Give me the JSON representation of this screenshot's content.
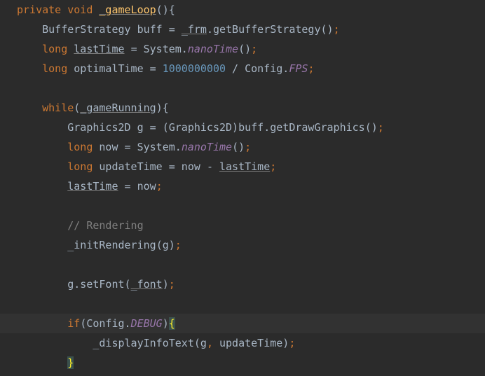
{
  "code": {
    "l1": {
      "kw1": "private",
      "kw2": "void",
      "fn": "_gameLoop",
      "p": "(){",
      "indent": ""
    },
    "l2": {
      "indent": "    ",
      "t1": "BufferStrategy buff ",
      "op": "=",
      "sp": " ",
      "fld": "_frm",
      "t2": ".getBufferStrategy()",
      "semi": ";"
    },
    "l3": {
      "indent": "    ",
      "kw": "long",
      "sp": " ",
      "var": "lastTime",
      "t1": " ",
      "op": "=",
      "t2": " System.",
      "stat": "nanoTime",
      "t3": "()",
      "semi": ";"
    },
    "l4": {
      "indent": "    ",
      "kw": "long",
      "t1": " optimalTime ",
      "op": "=",
      "sp": " ",
      "num": "1000000000",
      "t2": " / Config.",
      "stat": "FPS",
      "semi": ";"
    },
    "l5": {
      "blank": ""
    },
    "l6": {
      "indent": "    ",
      "kw": "while",
      "p1": "(",
      "fld": "_gameRunning",
      "p2": "){"
    },
    "l7": {
      "indent": "        ",
      "t1": "Graphics2D g ",
      "op": "=",
      "t2": " (Graphics2D)buff.getDrawGraphics()",
      "semi": ";"
    },
    "l8": {
      "indent": "        ",
      "kw": "long",
      "t1": " now ",
      "op": "=",
      "t2": " System.",
      "stat": "nanoTime",
      "t3": "()",
      "semi": ";"
    },
    "l9": {
      "indent": "        ",
      "kw": "long",
      "t1": " updateTime ",
      "op": "=",
      "t2": " now ",
      "op2": "-",
      "sp": " ",
      "var": "lastTime",
      "semi": ";"
    },
    "l10": {
      "indent": "        ",
      "var": "lastTime",
      "t1": " ",
      "op": "=",
      "t2": " now",
      "semi": ";"
    },
    "l11": {
      "blank": ""
    },
    "l12": {
      "indent": "        ",
      "com": "// Rendering"
    },
    "l13": {
      "indent": "        ",
      "fn": "_initRendering",
      "t1": "(g)",
      "semi": ";"
    },
    "l14": {
      "blank": ""
    },
    "l15": {
      "indent": "        ",
      "t1": "g.setFont(",
      "fld": "_font",
      "t2": ")",
      "semi": ";"
    },
    "l16": {
      "blank": ""
    },
    "l17": {
      "indent": "        ",
      "kw": "if",
      "p1": "(Config.",
      "stat": "DEBUG",
      "p2": ")",
      "brace": "{"
    },
    "l18": {
      "indent": "            ",
      "fn": "_displayInfoText",
      "t1": "(g",
      "comma": ",",
      "t2": " updateTime)",
      "semi": ";"
    },
    "l19": {
      "indent": "        ",
      "brace": "}"
    }
  }
}
